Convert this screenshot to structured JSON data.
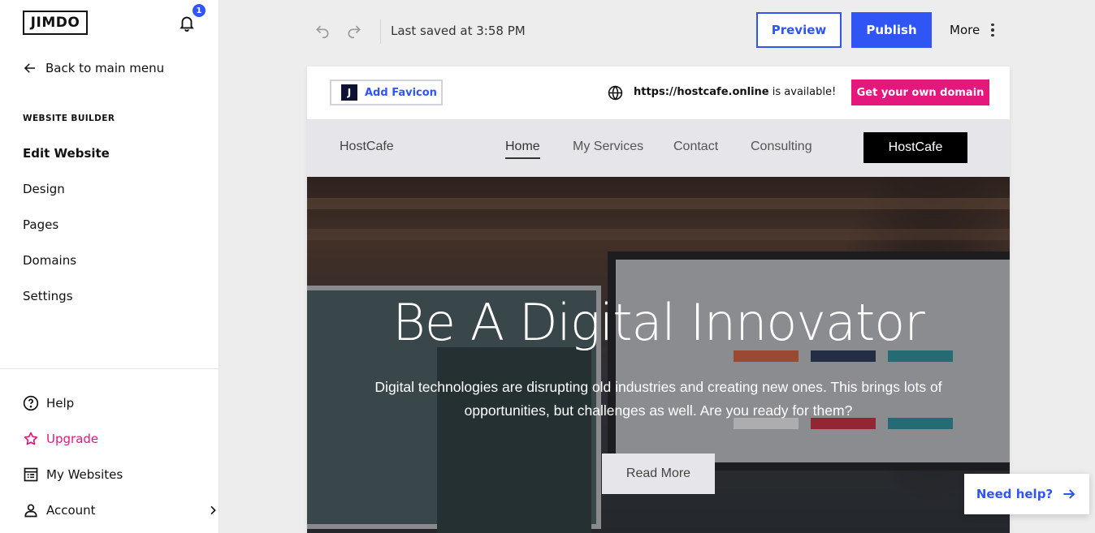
{
  "sidebar": {
    "logo": "JIMDO",
    "notifications_count": "1",
    "back_label": "Back to main menu",
    "section_label": "WEBSITE BUILDER",
    "items": [
      {
        "label": "Edit Website",
        "active": true
      },
      {
        "label": "Design"
      },
      {
        "label": "Pages"
      },
      {
        "label": "Domains"
      },
      {
        "label": "Settings"
      }
    ],
    "bottom_items": [
      {
        "label": "Help",
        "icon": "help-circle-icon"
      },
      {
        "label": "Upgrade",
        "icon": "star-icon",
        "color": "#e3177c"
      },
      {
        "label": "My Websites",
        "icon": "websites-list-icon"
      },
      {
        "label": "Account",
        "icon": "user-icon"
      }
    ]
  },
  "topbar": {
    "saved_text": "Last saved at 3:58 PM",
    "preview_label": "Preview",
    "publish_label": "Publish",
    "more_label": "More"
  },
  "domain_bar": {
    "favicon_label": "Add Favicon",
    "favicon_letter": "J",
    "domain": "https://hostcafe.online",
    "availability": "is available!",
    "cta_label": "Get your own domain"
  },
  "site": {
    "name": "HostCafe",
    "nav": [
      "Home",
      "My Services",
      "Contact",
      "Consulting"
    ],
    "nav_cta": "HostCafe",
    "hero": {
      "title": "Be A Digital Innovator",
      "subtitle": "Digital technologies are disrupting old industries and creating new ones. This brings lots of opportunities, but challenges as well. Are you ready for them?",
      "button_label": "Read More"
    }
  },
  "help_widget": {
    "label": "Need help?"
  },
  "colors": {
    "accent": "#2f55f5",
    "upgrade": "#e3177c",
    "domain_cta": "#e3177c"
  }
}
